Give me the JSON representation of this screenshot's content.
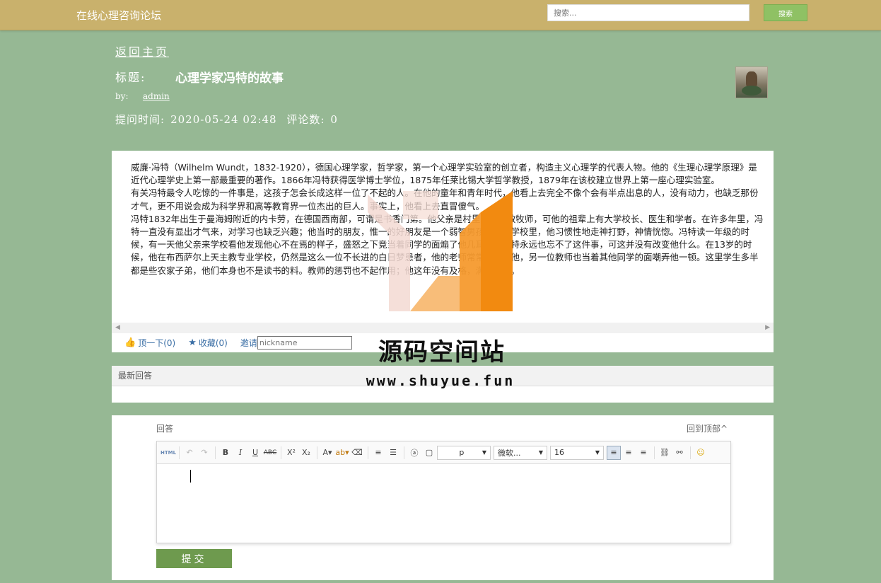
{
  "header": {
    "site_title": "在线心理咨询论坛",
    "search_placeholder": "搜索...",
    "search_button": "搜索"
  },
  "post": {
    "back_home": "返回主页",
    "title_label": "标题:",
    "title": "心理学家冯特的故事",
    "by_label": "by:",
    "author": "admin",
    "time_label": "提问时间:",
    "time": "2020-05-24 02:48",
    "comments_label": "评论数:",
    "comments": "0",
    "body": [
      "威廉·冯特（Wilhelm Wundt，1832-1920），德国心理学家，哲学家，第一个心理学实验室的创立者，构造主义心理学的代表人物。他的《生理心理学原理》是近代心理学史上第一部最重要的著作。1866年冯特获得医学博士学位，1875年任莱比锡大学哲学教授，1879年在该校建立世界上第一座心理实验室。",
      "有关冯特最令人吃惊的一件事是，这孩子怎会长成这样一位了不起的人。在他的童年和青年时代，他看上去完全不像个会有半点出息的人，没有动力，也缺乏那份才气，更不用说会成为科学界和高等教育界一位杰出的巨人。事实上，他看上去直冒傻气。",
      "冯特1832年出生于曼海姆附近的内卡劳，在德国西南部，可谓是书香门第。他父亲是村里的路德教牧师，可他的祖辈上有大学校长、医生和学者。在许多年里，冯特一直没有显出才气来，对学习也缺乏兴趣；他当时的朋友，惟一的好朋友是一个弱智男孩，而在学校里，他习惯性地走神打野，神情恍惚。冯特读一年级的时候，有一天他父亲来学校看他发现他心不在焉的样子，盛怒之下竟当着同学的面煽了他几耳光。冯特永远也忘不了这件事，可这并没有改变他什么。在13岁的时候，他在布西萨尔上天主教专业学校，仍然是这么一位不长进的白日梦患者，他的老师常常公开煽他，另一位教师也当着其他同学的面嘲弄他一顿。这里学生多半都是些农家子弟，他们本身也不是读书的料。教师的惩罚也不起作用；他这年没有及格，满面无光。"
    ],
    "like": "顶一下(0)",
    "favorite": "收藏(0)",
    "invite": "邀请",
    "nickname_placeholder": "nickname"
  },
  "latest": {
    "heading": "最新回答"
  },
  "reply": {
    "label": "回答",
    "back_top": "回到顶部^",
    "format_value": "p",
    "font_value": "微软...",
    "size_value": "16",
    "submit": "提交"
  },
  "watermark": {
    "text": "源码空间站",
    "url": "www.shuyue.fun"
  },
  "colors": {
    "background": "#96b894",
    "topbar": "#c9b16c",
    "accent": "#8fc164",
    "submit": "#6e9a4e"
  }
}
